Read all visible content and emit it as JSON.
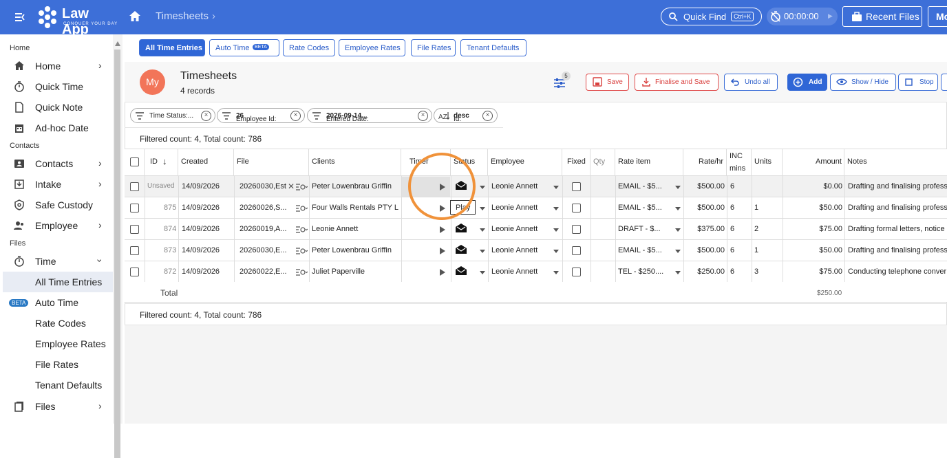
{
  "app": {
    "brand": "Law App",
    "tagline": "CONQUER YOUR DAY",
    "breadcrumb": "Timesheets"
  },
  "topbar": {
    "quick_find": "Quick Find",
    "quick_find_kbd": "Ctrl+K",
    "timer": "00:00:00",
    "recent_files": "Recent Files",
    "more": "Mo"
  },
  "sidebar": {
    "sections": [
      "Home",
      "Contacts",
      "Files"
    ],
    "items": [
      {
        "label": "Home",
        "icon": "home-icon"
      },
      {
        "label": "Quick Time",
        "icon": "stopwatch-icon"
      },
      {
        "label": "Quick Note",
        "icon": "note-icon"
      },
      {
        "label": "Ad-hoc Date",
        "icon": "calendar-icon"
      },
      {
        "label": "Contacts",
        "icon": "contacts-icon"
      },
      {
        "label": "Intake",
        "icon": "intake-icon"
      },
      {
        "label": "Safe Custody",
        "icon": "safe-custody-icon"
      },
      {
        "label": "Employee",
        "icon": "employee-icon"
      },
      {
        "label": "Time",
        "icon": "stopwatch-icon"
      },
      {
        "label": "All Time Entries"
      },
      {
        "label": "Auto Time",
        "badge": "BETA"
      },
      {
        "label": "Rate Codes"
      },
      {
        "label": "Employee Rates"
      },
      {
        "label": "File Rates"
      },
      {
        "label": "Tenant Defaults"
      },
      {
        "label": "Files",
        "icon": "files-icon"
      }
    ]
  },
  "tabs": [
    {
      "label": "All Time Entries"
    },
    {
      "label": "Auto Time",
      "badge": "BETA"
    },
    {
      "label": "Rate Codes"
    },
    {
      "label": "Employee Rates"
    },
    {
      "label": "File Rates"
    },
    {
      "label": "Tenant Defaults"
    }
  ],
  "header": {
    "avatar": "My",
    "title": "Timesheets",
    "records": "4 records",
    "filter_count": "5",
    "buttons": {
      "save": "Save",
      "finalise": "Finalise and Save",
      "undo": "Undo all",
      "add": "Add",
      "show_hide": "Show / Hide",
      "stop": "Stop"
    }
  },
  "filters": [
    {
      "label": "Time Status:...",
      "bold": ""
    },
    {
      "label": "Employee Id:",
      "bold": "26"
    },
    {
      "label": "Entered Date:",
      "bold": "2026-09-14..."
    },
    {
      "label": "Id:",
      "bold": "desc"
    }
  ],
  "count_text": "Filtered count: 4, Total count: 786",
  "columns": {
    "id": "ID",
    "created": "Created",
    "file": "File",
    "clients": "Clients",
    "timer": "Timer",
    "status": "Status",
    "employee": "Employee",
    "fixed": "Fixed",
    "qty": "Qty",
    "rate_item": "Rate item",
    "rate_hr": "Rate/hr",
    "inc": "INC",
    "mins": "mins",
    "units": "Units",
    "amount": "Amount",
    "notes": "Notes"
  },
  "rows": [
    {
      "id": "Unsaved",
      "created": "14/09/2026",
      "file": "20260030,Est",
      "client": "Peter Lowenbrau Griffin",
      "employee": "Leonie Annett",
      "rate_item": "EMAIL - $5...",
      "rate": "$500.00",
      "inc": "6",
      "units": "",
      "amount": "$0.00",
      "notes": "Drafting and finalising profess"
    },
    {
      "id": "875",
      "created": "14/09/2026",
      "file": "20260026,S...",
      "client": "Four Walls Rentals PTY L",
      "employee": "Leonie Annett",
      "rate_item": "EMAIL - $5...",
      "rate": "$500.00",
      "inc": "6",
      "units": "1",
      "amount": "$50.00",
      "notes": "Drafting and finalising profess"
    },
    {
      "id": "874",
      "created": "14/09/2026",
      "file": "20260019,A...",
      "client": "Leonie Annett",
      "employee": "Leonie Annett",
      "rate_item": "DRAFT - $...",
      "rate": "$375.00",
      "inc": "6",
      "units": "2",
      "amount": "$75.00",
      "notes": "Drafting formal letters, notice"
    },
    {
      "id": "873",
      "created": "14/09/2026",
      "file": "20260030,E...",
      "client": "Peter Lowenbrau Griffin",
      "employee": "Leonie Annett",
      "rate_item": "EMAIL - $5...",
      "rate": "$500.00",
      "inc": "6",
      "units": "1",
      "amount": "$50.00",
      "notes": "Drafting and finalising profess"
    },
    {
      "id": "872",
      "created": "14/09/2026",
      "file": "20260022,E...",
      "client": "Juliet Paperville",
      "employee": "Leonie Annett",
      "rate_item": "TEL - $250....",
      "rate": "$250.00",
      "inc": "6",
      "units": "3",
      "amount": "$75.00",
      "notes": "Conducting telephone conver"
    }
  ],
  "total": {
    "label": "Total",
    "value": "$250.00"
  },
  "tooltip": "Play",
  "colors": {
    "primary": "#3d6fd8",
    "danger": "#d9413f",
    "avatar": "#f27559",
    "highlight": "#f0923a"
  }
}
